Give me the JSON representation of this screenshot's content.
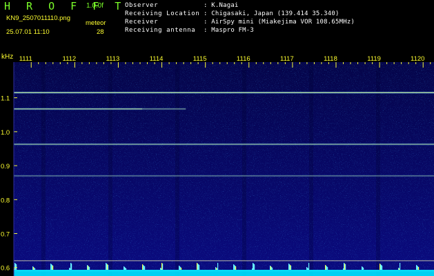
{
  "header": {
    "app_title": "H R O F F T",
    "app_version": "1.0.0f",
    "file_name": "KN9_2507011110.png",
    "meteor_label": "meteor",
    "timestamp": "25.07.01 11:10",
    "meteor_count": "28"
  },
  "info": [
    {
      "key": "Observer",
      "value": ": K.Nagai"
    },
    {
      "key": "Receiving Location",
      "value": ": Chigasaki, Japan (139.414 35.340)"
    },
    {
      "key": "Receiver",
      "value": ": AirSpy mini (Miakejima VOR 108.65MHz)"
    },
    {
      "key": "Receiving antenna",
      "value": ": Maspro FM-3"
    }
  ],
  "colors": {
    "background": "#000000",
    "spectrogram_base": "#0a0a78",
    "header_title": "#7cff2a",
    "header_meta": "#ffff30",
    "info_text": "#ffffff",
    "axis_text": "#ffff30",
    "tick_color": "#ffff30",
    "signal_line": "#c8f0a0",
    "noise_floor": "#00e5ff"
  },
  "chart_data": {
    "type": "heatmap",
    "y_unit_label": "kHz",
    "x_ticks": [
      "1111",
      "1112",
      "1113",
      "1114",
      "1115",
      "1116",
      "1117",
      "1118",
      "1119",
      "1120"
    ],
    "y_ticks": [
      "1.1",
      "1.0",
      "0.9",
      "0.8",
      "0.7",
      "0.6"
    ],
    "ylim": [
      0.575,
      1.205
    ],
    "xlim": [
      1110.6,
      1120.25
    ],
    "signal_lines": [
      {
        "freq_khz": 1.115,
        "x_from": 1110.6,
        "x_to": 1120.25,
        "brightness": 1.0
      },
      {
        "freq_khz": 1.067,
        "x_from": 1110.6,
        "x_to": 1113.55,
        "brightness": 0.9
      },
      {
        "freq_khz": 1.067,
        "x_from": 1113.55,
        "x_to": 1114.55,
        "brightness": 0.55
      },
      {
        "freq_khz": 0.963,
        "x_from": 1110.6,
        "x_to": 1120.25,
        "brightness": 0.8
      },
      {
        "freq_khz": 0.87,
        "x_from": 1110.6,
        "x_to": 1120.25,
        "brightness": 0.45
      }
    ],
    "reference_lines_khz": [
      0.62,
      0.59
    ]
  }
}
